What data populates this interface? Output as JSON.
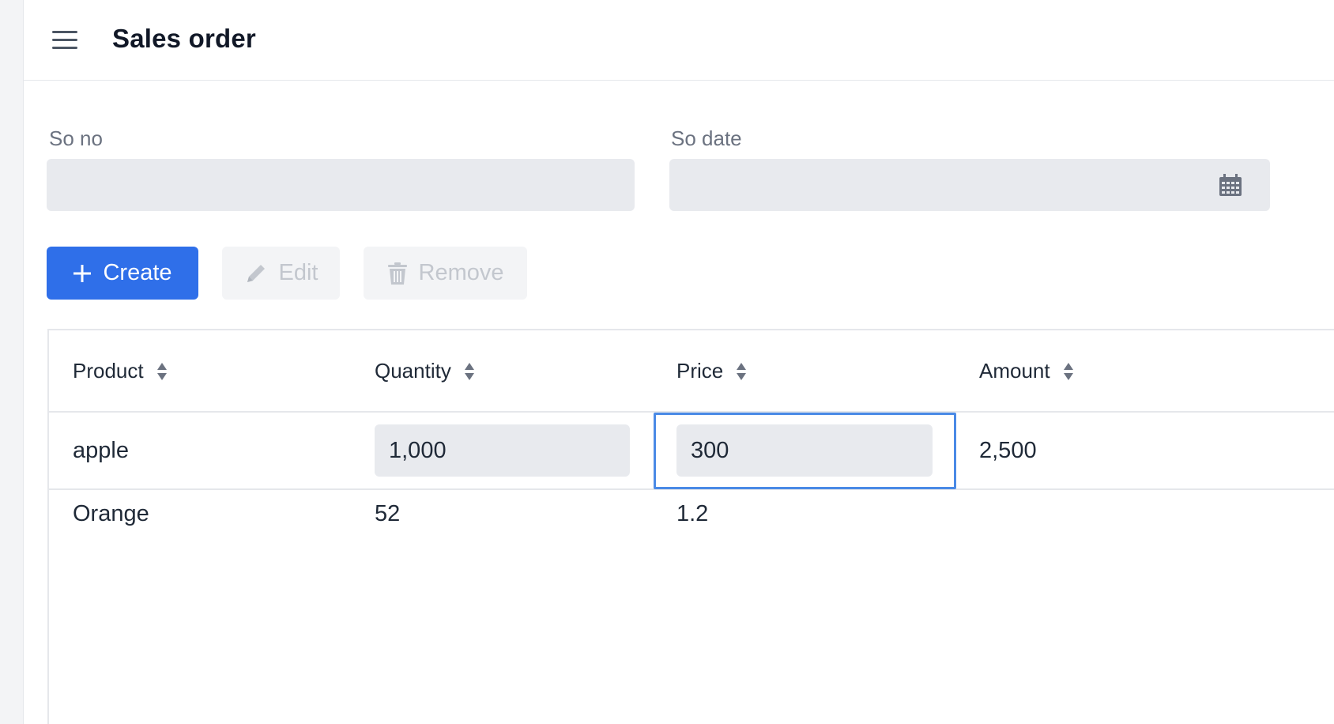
{
  "header": {
    "title": "Sales order",
    "menu_icon": "hamburger-menu-icon"
  },
  "form": {
    "so_no": {
      "label": "So no",
      "value": ""
    },
    "so_date": {
      "label": "So date",
      "value": "",
      "icon": "calendar-icon"
    }
  },
  "toolbar": {
    "create_label": "Create",
    "edit_label": "Edit",
    "remove_label": "Remove"
  },
  "table": {
    "columns": [
      "Product",
      "Quantity",
      "Price",
      "Amount"
    ],
    "rows": [
      {
        "product": "apple",
        "quantity": "1,000",
        "price": "300",
        "amount": "2,500"
      },
      {
        "product": "Orange",
        "quantity": "52",
        "price": "1.2",
        "amount": ""
      }
    ]
  },
  "colors": {
    "accent": "#2f6fe9",
    "focus": "#4a8ae6",
    "input_bg": "#e8eaee"
  }
}
